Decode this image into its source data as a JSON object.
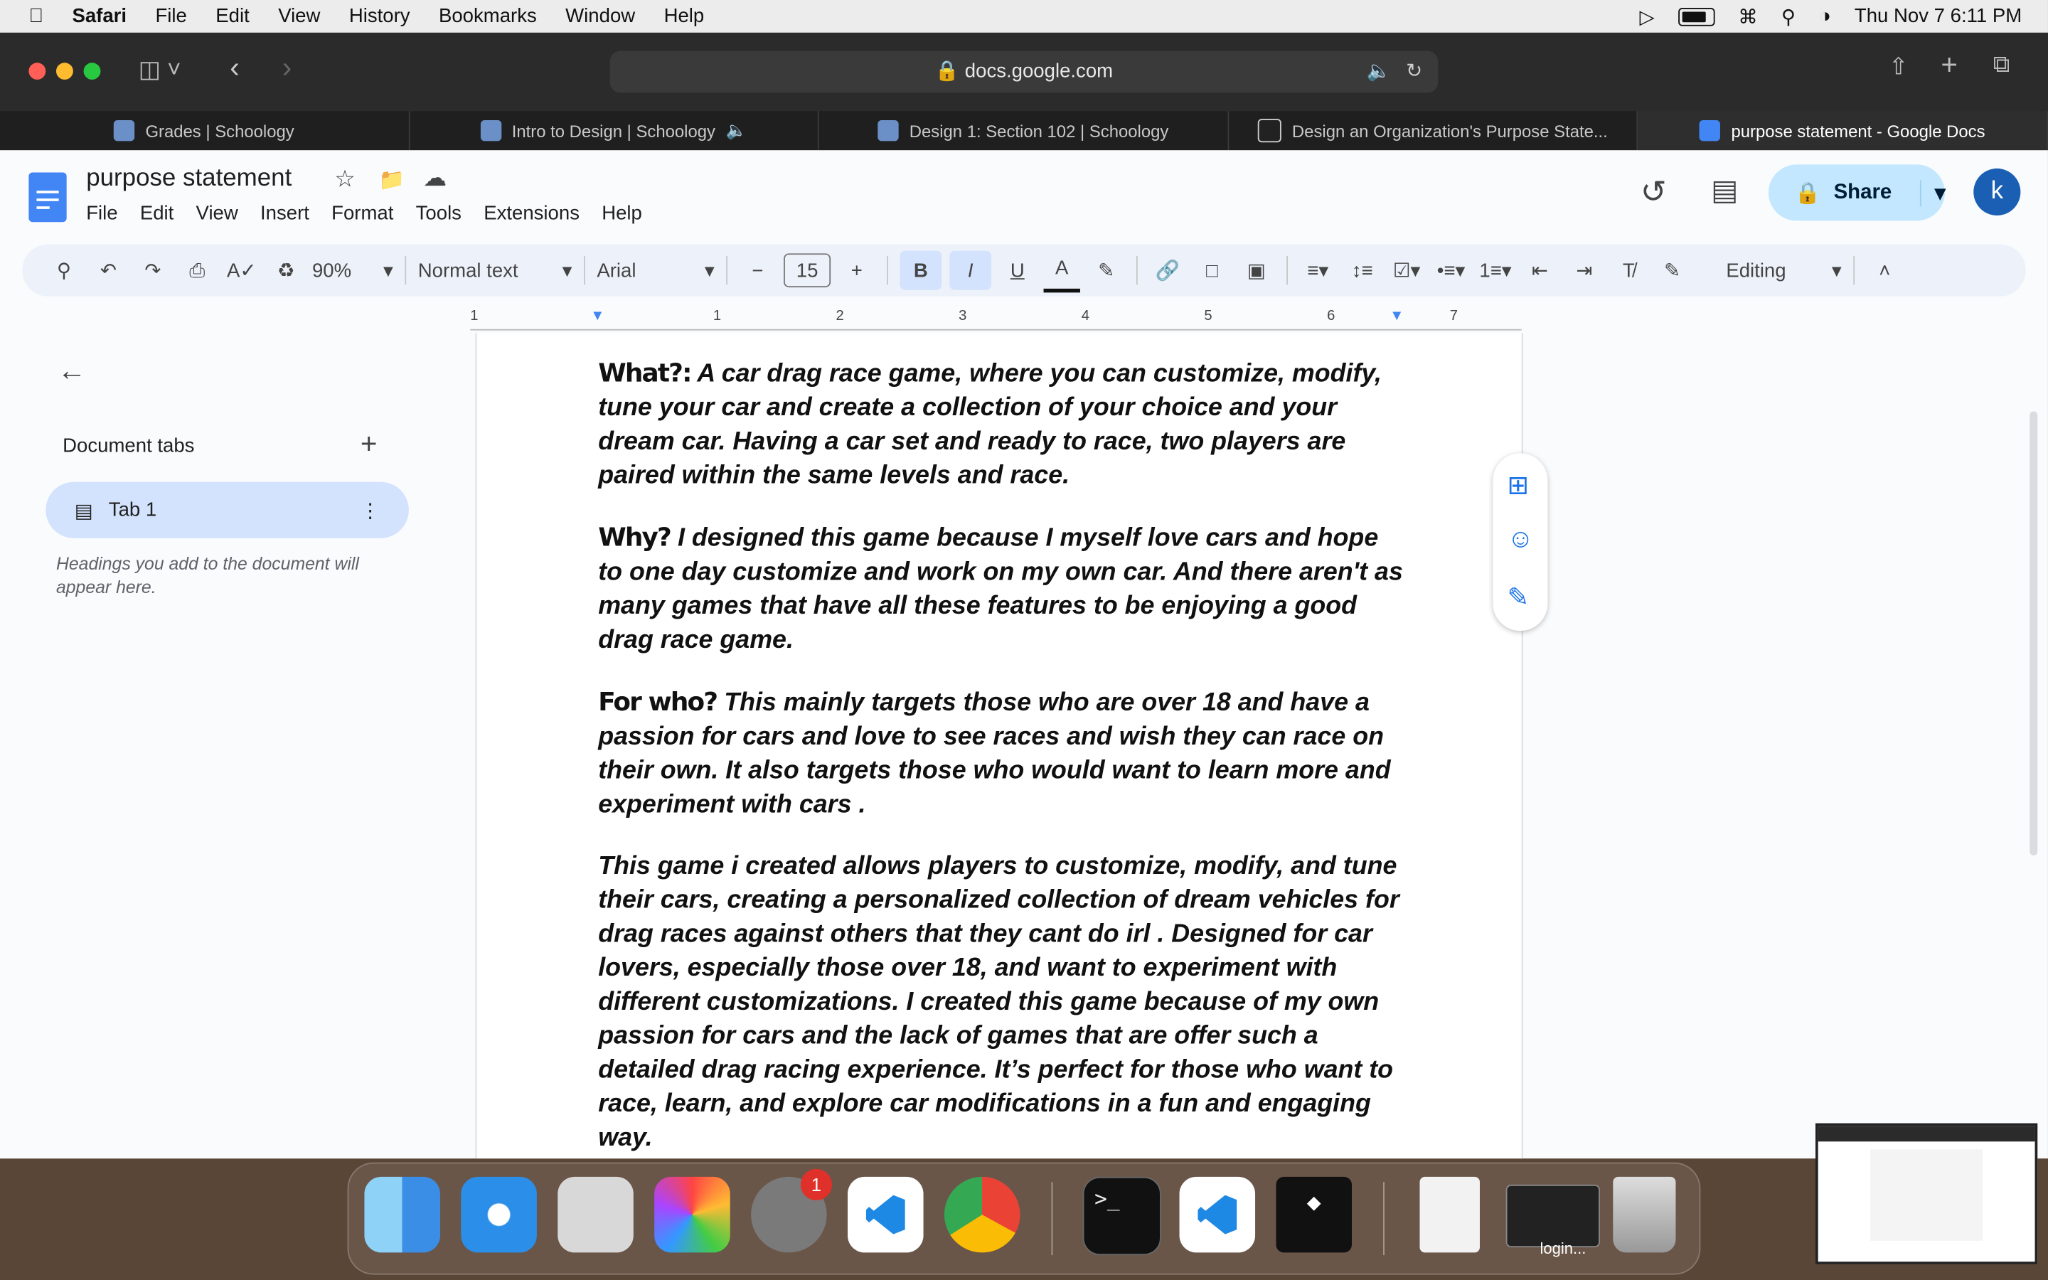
{
  "menubar": {
    "app": "Safari",
    "items": [
      "File",
      "Edit",
      "View",
      "History",
      "Bookmarks",
      "Window",
      "Help"
    ],
    "datetime": "Thu Nov 7  6:11 PM"
  },
  "safari": {
    "url": "docs.google.com",
    "tabs": [
      {
        "label": "Grades | Schoology"
      },
      {
        "label": "Intro to Design | Schoology"
      },
      {
        "label": "Design 1: Section 102 | Schoology"
      },
      {
        "label": "Design an Organization's Purpose State..."
      },
      {
        "label": "purpose statement - Google Docs"
      }
    ]
  },
  "docs": {
    "title": "purpose statement",
    "menu": [
      "File",
      "Edit",
      "View",
      "Insert",
      "Format",
      "Tools",
      "Extensions",
      "Help"
    ],
    "share_label": "Share",
    "avatar_letter": "k",
    "toolbar": {
      "zoom": "90%",
      "style": "Normal text",
      "font": "Arial",
      "font_size": "15",
      "mode": "Editing"
    },
    "ruler_labels": [
      "1",
      "1",
      "2",
      "3",
      "4",
      "5",
      "6",
      "7"
    ],
    "sidebar": {
      "heading": "Document tabs",
      "tab_name": "Tab 1",
      "hint": "Headings you add to the document will appear here."
    },
    "paragraphs": [
      {
        "label": "What?:",
        "text": " A car drag race game, where you can customize, modify, tune your car and create a collection of your choice and your dream car. Having a car set and ready to race, two players are paired within the same levels and race."
      },
      {
        "label": "Why?",
        "text": " I designed this game because I myself love cars and hope to one day customize and work on my own car. And there aren't as many games that have all these features to be enjoying a good drag race game."
      },
      {
        "label": "For who?",
        "text": " This mainly targets those who are over 18 and have a passion for cars and love to see races and wish they can race on their own. It also targets those who would want to learn more and experiment with cars ."
      },
      {
        "label": "",
        "text": "This game i created allows players to customize, modify, and tune their cars, creating a personalized collection of dream vehicles for drag races against others that they cant do irl . Designed for car lovers, especially those over 18, and want to experiment with different customizations. I created this game because of my own passion for cars and the lack of games that are offer such a detailed drag racing experience. It’s perfect for those who want to race, learn, and explore car modifications in a fun and engaging way."
      }
    ]
  },
  "dock": {
    "settings_badge": "1",
    "login_label": "login..."
  },
  "colors": {
    "docs_blue": "#4285f4",
    "share_bg": "#c2e7ff",
    "tab_selected": "#d3e3fd",
    "mac_red": "#ff5f57",
    "mac_yellow": "#febc2e",
    "mac_green": "#28c840"
  }
}
